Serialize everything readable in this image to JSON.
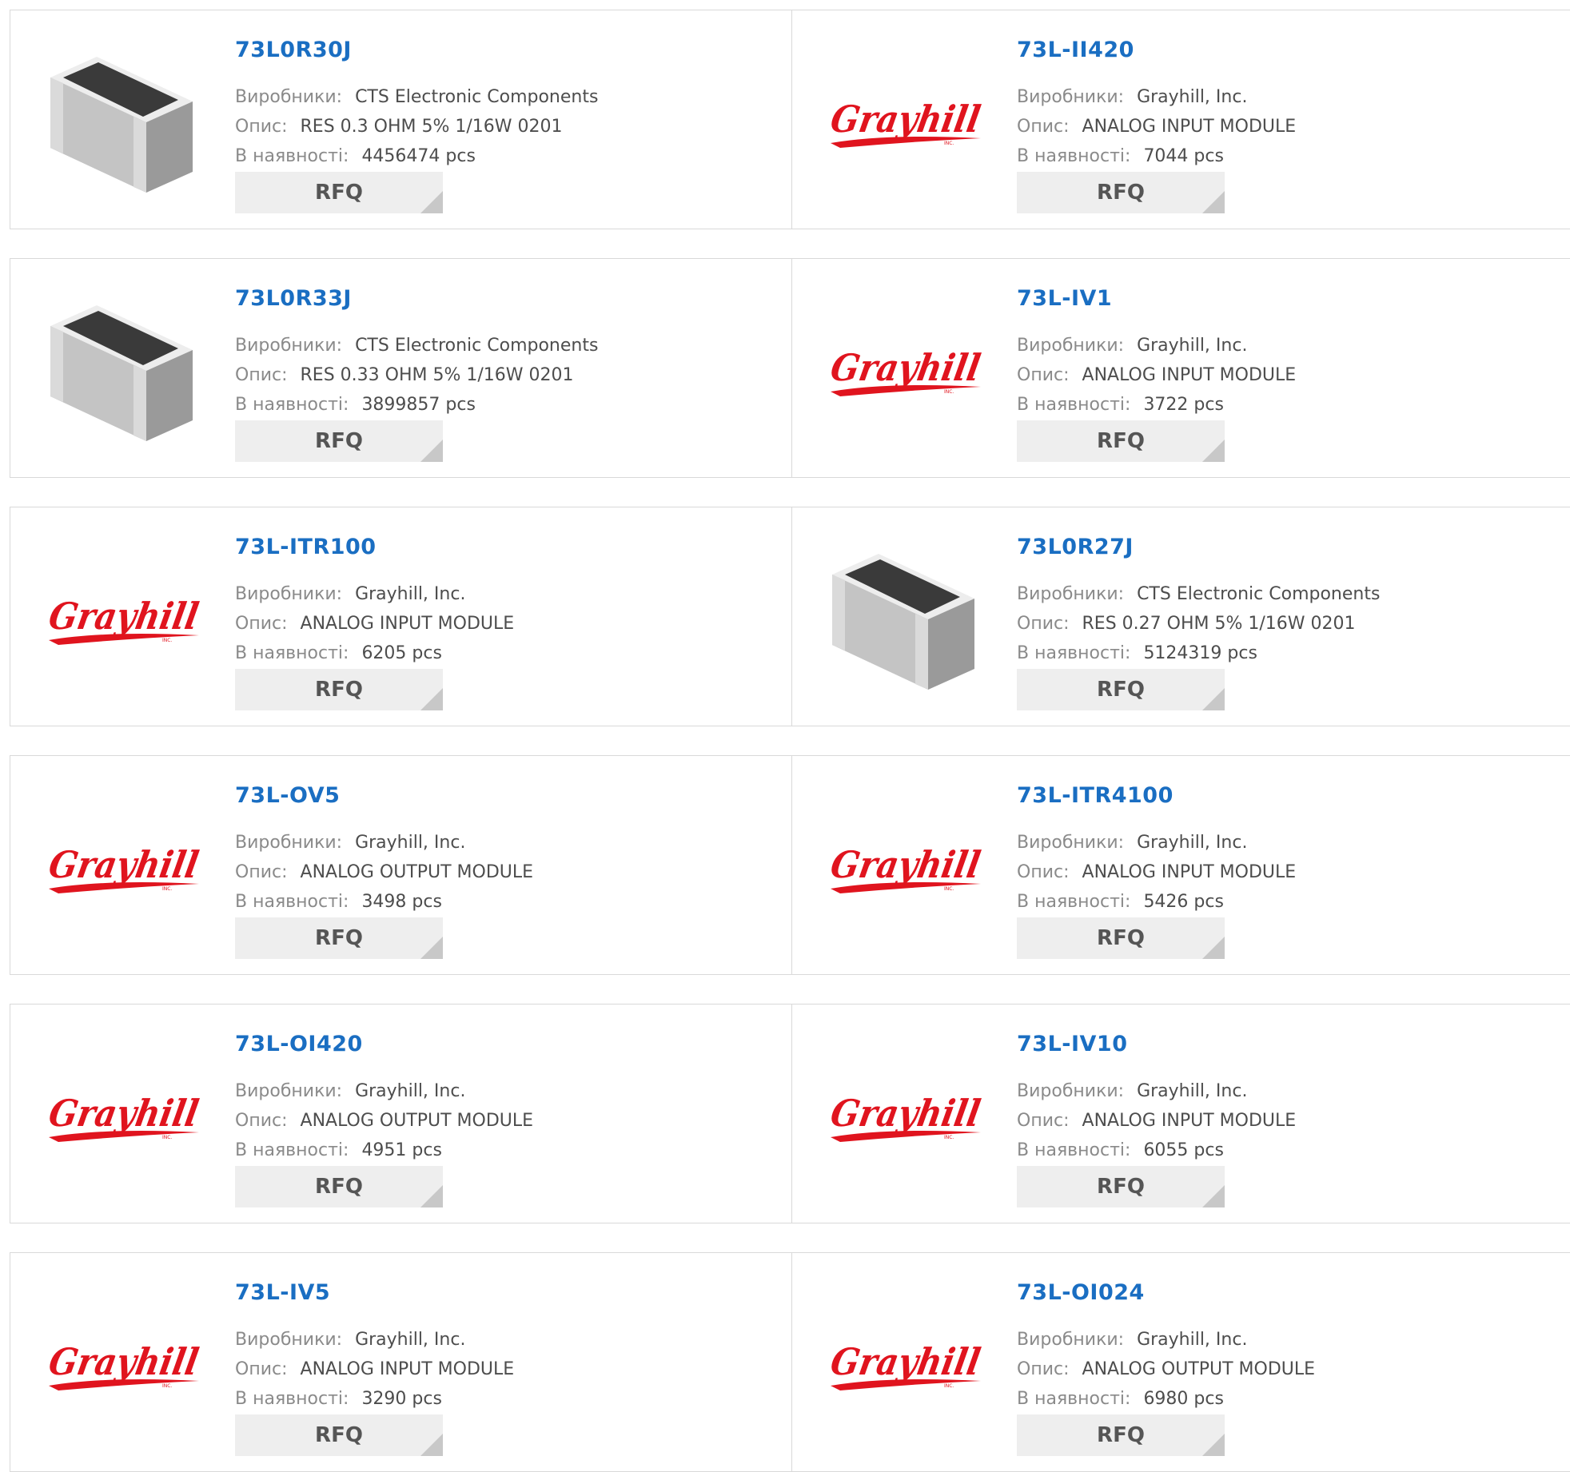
{
  "labels": {
    "manufacturer": "Виробники:",
    "description": "Опис:",
    "stock": "В наявності:",
    "rfq": "RFQ"
  },
  "logo": {
    "grayhill": {
      "text": "Grayhill",
      "sub": "INC."
    }
  },
  "colors": {
    "part_link": "#1a6ec2",
    "logo_red": "#e0141e",
    "rfq_bg": "#eeeeee"
  },
  "rows": [
    [
      {
        "part": "73L0R30J",
        "manufacturer": "CTS Electronic Components",
        "description": "RES 0.3 OHM 5% 1/16W 0201",
        "stock": "4456474 pcs",
        "image": "resistor-chip-image"
      },
      {
        "part": "73L-II420",
        "manufacturer": "Grayhill, Inc.",
        "description": "ANALOG INPUT MODULE",
        "stock": "7044 pcs",
        "image": "grayhill-logo"
      }
    ],
    [
      {
        "part": "73L0R33J",
        "manufacturer": "CTS Electronic Components",
        "description": "RES 0.33 OHM 5% 1/16W 0201",
        "stock": "3899857 pcs",
        "image": "resistor-chip-image"
      },
      {
        "part": "73L-IV1",
        "manufacturer": "Grayhill, Inc.",
        "description": "ANALOG INPUT MODULE",
        "stock": "3722 pcs",
        "image": "grayhill-logo"
      }
    ],
    [
      {
        "part": "73L-ITR100",
        "manufacturer": "Grayhill, Inc.",
        "description": "ANALOG INPUT MODULE",
        "stock": "6205 pcs",
        "image": "grayhill-logo"
      },
      {
        "part": "73L0R27J",
        "manufacturer": "CTS Electronic Components",
        "description": "RES 0.27 OHM 5% 1/16W 0201",
        "stock": "5124319 pcs",
        "image": "resistor-chip-image"
      }
    ],
    [
      {
        "part": "73L-OV5",
        "manufacturer": "Grayhill, Inc.",
        "description": "ANALOG OUTPUT MODULE",
        "stock": "3498 pcs",
        "image": "grayhill-logo"
      },
      {
        "part": "73L-ITR4100",
        "manufacturer": "Grayhill, Inc.",
        "description": "ANALOG INPUT MODULE",
        "stock": "5426 pcs",
        "image": "grayhill-logo"
      }
    ],
    [
      {
        "part": "73L-OI420",
        "manufacturer": "Grayhill, Inc.",
        "description": "ANALOG OUTPUT MODULE",
        "stock": "4951 pcs",
        "image": "grayhill-logo"
      },
      {
        "part": "73L-IV10",
        "manufacturer": "Grayhill, Inc.",
        "description": "ANALOG INPUT MODULE",
        "stock": "6055 pcs",
        "image": "grayhill-logo"
      }
    ],
    [
      {
        "part": "73L-IV5",
        "manufacturer": "Grayhill, Inc.",
        "description": "ANALOG INPUT MODULE",
        "stock": "3290 pcs",
        "image": "grayhill-logo"
      },
      {
        "part": "73L-OI024",
        "manufacturer": "Grayhill, Inc.",
        "description": "ANALOG OUTPUT MODULE",
        "stock": "6980 pcs",
        "image": "grayhill-logo"
      }
    ]
  ]
}
